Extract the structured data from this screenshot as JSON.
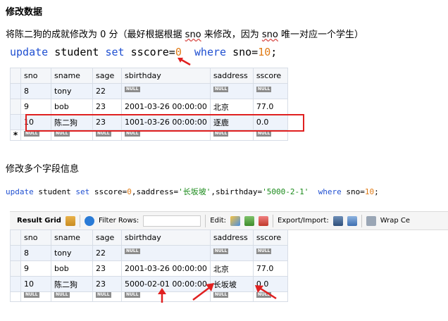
{
  "heading": "修改数据",
  "description": {
    "before": "将陈二狗的成就修改为 0 分（最好根据根据 ",
    "sno1": "sno",
    "middle": " 来修改，因为 ",
    "sno2": "sno",
    "after": " 唯一对应一个学生）"
  },
  "sql1": {
    "update": "update",
    "table": " student ",
    "set": "set",
    "assign": " sscore=",
    "value": "0",
    "gap": "  ",
    "where": "where",
    "cond": " sno=",
    "cond_val": "10",
    "end": ";"
  },
  "grid1": {
    "columns": [
      "sno",
      "sname",
      "sage",
      "sbirthday",
      "saddress",
      "sscore"
    ],
    "rows": [
      [
        "8",
        "tony",
        "22",
        "NULL",
        "NULL",
        "NULL"
      ],
      [
        "9",
        "bob",
        "23",
        "2001-03-26 00:00:00",
        "北京",
        "77.0"
      ],
      [
        "10",
        "陈二狗",
        "23",
        "1001-03-26 00:00:00",
        "逐鹿",
        "0.0"
      ]
    ],
    "null_label": "NULL",
    "new_row_marker": "*"
  },
  "section2": "修改多个字段信息",
  "sql2": {
    "update": "update",
    "table": " student ",
    "set": "set",
    "assign1": " sscore=",
    "v1": "0",
    "assign2": ",saddress=",
    "v2": "'长坂坡'",
    "assign3": ",sbirthday=",
    "v3": "'5000-2-1'",
    "gap": "  ",
    "where": "where",
    "cond": " sno=",
    "cond_val": "10",
    "end": ";"
  },
  "toolbar": {
    "result_grid": "Result Grid",
    "filter_rows": "Filter Rows:",
    "edit": "Edit:",
    "export_import": "Export/Import:",
    "wrap": "Wrap Ce"
  },
  "grid2": {
    "columns": [
      "sno",
      "sname",
      "sage",
      "sbirthday",
      "saddress",
      "sscore"
    ],
    "rows": [
      [
        "8",
        "tony",
        "22",
        "NULL",
        "NULL",
        "NULL"
      ],
      [
        "9",
        "bob",
        "23",
        "2001-03-26 00:00:00",
        "北京",
        "77.0"
      ],
      [
        "10",
        "陈二狗",
        "23",
        "5000-02-01 00:00:00",
        "长坂坡",
        "0.0"
      ]
    ],
    "null_label": "NULL"
  },
  "colors": {
    "keyword": "#1f4fd1",
    "number": "#e07b16",
    "string": "#1a8a1a",
    "highlight": "#e02020"
  }
}
